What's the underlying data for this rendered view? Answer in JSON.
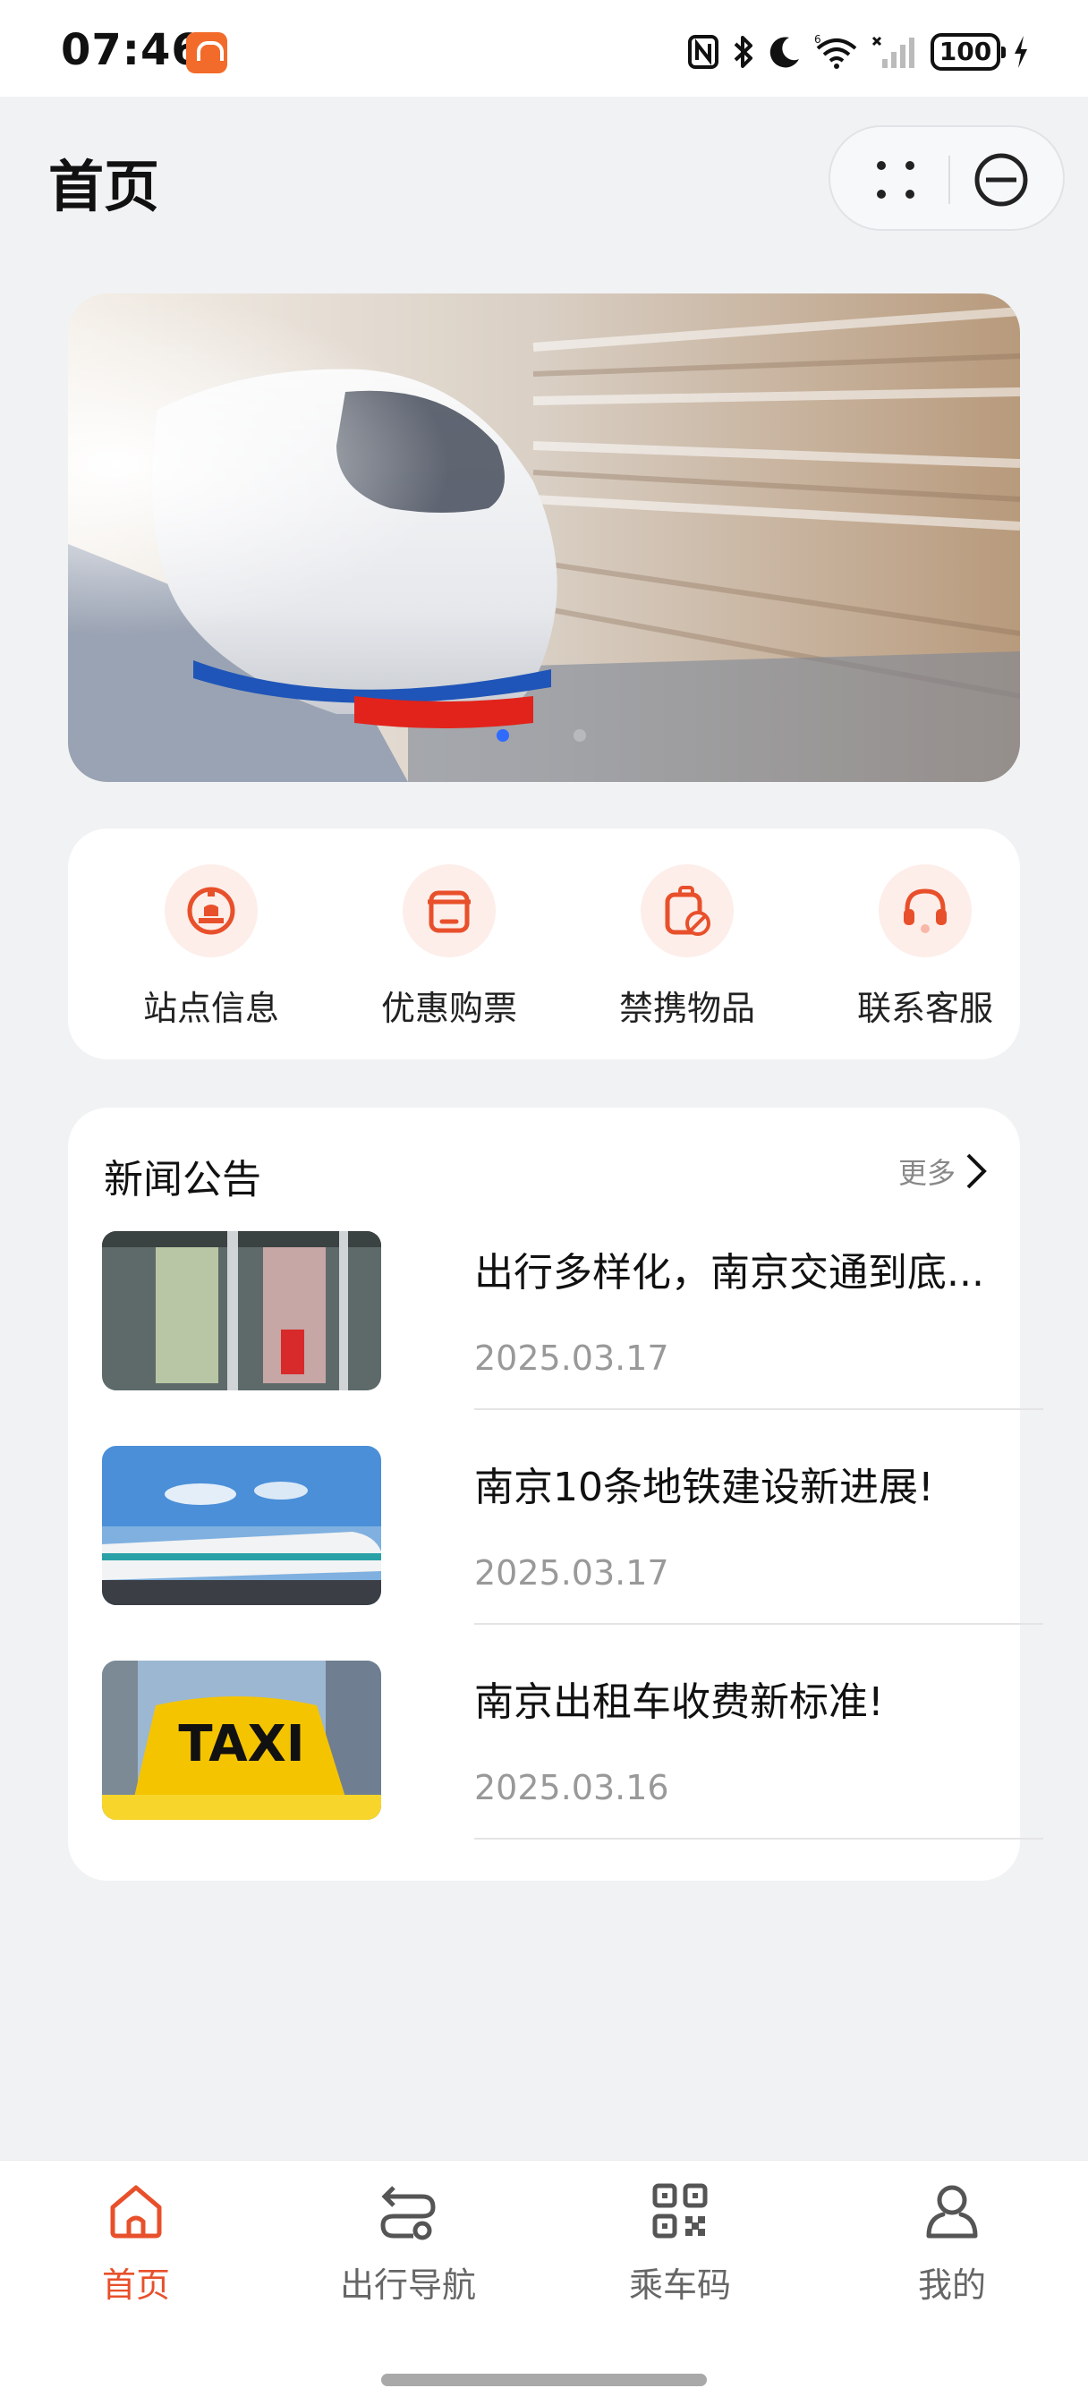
{
  "status_bar": {
    "time": "07:46",
    "battery": "100",
    "app_icon": "nanjing-metro-app-icon"
  },
  "header": {
    "title": "首页",
    "more_icon": "dots-grid-icon",
    "close_icon": "minus-circle-icon"
  },
  "banner": {
    "image": "high-speed-train-photo",
    "page_count": 2,
    "active_page": 0
  },
  "quick_menu": {
    "items": [
      {
        "label": "站点信息",
        "icon": "station-icon"
      },
      {
        "label": "优惠购票",
        "icon": "ticket-icon"
      },
      {
        "label": "禁携物品",
        "icon": "prohibited-luggage-icon"
      },
      {
        "label": "联系客服",
        "icon": "headset-icon"
      }
    ]
  },
  "news": {
    "title": "新闻公告",
    "more_label": "更多",
    "items": [
      {
        "headline": "出行多样化，南京交通到底...",
        "date": "2025.03.17",
        "thumb": "bus-interior-photo"
      },
      {
        "headline": "南京10条地铁建设新进展!",
        "date": "2025.03.17",
        "thumb": "metro-train-photo"
      },
      {
        "headline": "南京出租车收费新标准!",
        "date": "2025.03.16",
        "thumb": "taxi-sign-photo"
      }
    ]
  },
  "tabbar": {
    "tabs": [
      {
        "label": "首页",
        "icon": "home-icon",
        "active": true
      },
      {
        "label": "出行导航",
        "icon": "route-icon",
        "active": false
      },
      {
        "label": "乘车码",
        "icon": "qr-code-icon",
        "active": false
      },
      {
        "label": "我的",
        "icon": "user-icon",
        "active": false
      }
    ]
  },
  "colors": {
    "accent": "#e8502b",
    "accent_light": "#fdeeea",
    "background": "#f1f2f4",
    "banner_dot_active": "#2f6bff"
  }
}
